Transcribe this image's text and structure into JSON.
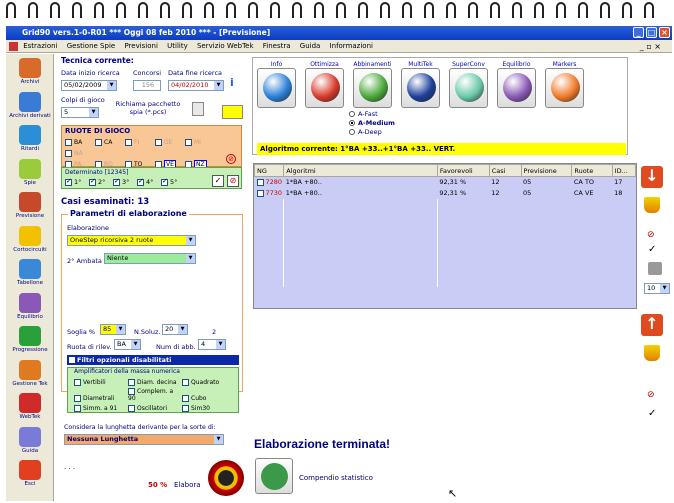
{
  "window": {
    "title": "Grid90 vers.1-0-R01  ***  Oggi 08 feb 2010  ***  - [Previsione]"
  },
  "menu": [
    "Estrazioni",
    "Gestione Spie",
    "Previsioni",
    "Utility",
    "Servizio WebTek",
    "Finestra",
    "Guida",
    "Informazioni"
  ],
  "sidebar": [
    {
      "label": "Archivi",
      "color": "#d86b2a"
    },
    {
      "label": "Archivi derivati",
      "color": "#3a7bd5"
    },
    {
      "label": "Ritardi",
      "color": "#2a8fd6"
    },
    {
      "label": "Spie",
      "color": "#9acb3a"
    },
    {
      "label": "Previsione",
      "color": "#c64a2a"
    },
    {
      "label": "Cortocircuiti",
      "color": "#f2c200"
    },
    {
      "label": "Tabellone",
      "color": "#3a88d8"
    },
    {
      "label": "Equilibrio",
      "color": "#8a58b5"
    },
    {
      "label": "Progressione",
      "color": "#2aa03a"
    },
    {
      "label": "Gestione Tek",
      "color": "#e07a20"
    },
    {
      "label": "WebTek",
      "color": "#d02a2a"
    },
    {
      "label": "Guida",
      "color": "#7a7ad8"
    },
    {
      "label": "Esci",
      "color": "#e04020"
    }
  ],
  "left": {
    "section_title": "Tecnica corrente:",
    "data_inizio_label": "Data inizio ricerca",
    "data_inizio": "05/02/2009",
    "concorsi_label": "Concorsi",
    "concorsi": "156",
    "data_fine_label": "Data fine ricerca",
    "data_fine": "04/02/2010",
    "colpi_label": "Colpi di gioco",
    "colpi": "5",
    "richiama_label": "Richiama pacchetto spia (*.pcs)",
    "ruote_title": "RUOTE DI GIOCO",
    "ruote": [
      {
        "name": "BA",
        "checked": false,
        "active": true
      },
      {
        "name": "CA",
        "checked": false,
        "active": true
      },
      {
        "name": "FI",
        "checked": false,
        "active": false
      },
      {
        "name": "GE",
        "checked": false,
        "active": false
      },
      {
        "name": "MI",
        "checked": false,
        "active": false
      },
      {
        "name": "NA",
        "checked": false,
        "active": false
      },
      {
        "name": "PA",
        "checked": false,
        "active": false
      },
      {
        "name": "RO",
        "checked": false,
        "active": false
      },
      {
        "name": "TO",
        "checked": false,
        "active": true
      },
      {
        "name": "VE",
        "checked": true,
        "active": true
      },
      {
        "name": "NZ",
        "checked": true,
        "active": true
      }
    ],
    "determinato_title": "Determinato [12345]",
    "determinato": [
      "1°",
      "2°",
      "3°",
      "4°",
      "5°"
    ],
    "casi_esaminati": "Casi esaminati: 13",
    "parametri_title": "Parametri di elaborazione",
    "elaborazione_label": "Elaborazione",
    "elaborazione": "OneStep ricorsiva 2 ruote",
    "ambata_label": "2° Ambata",
    "ambata": "Niente",
    "soglia_label": "Soglia %",
    "soglia": "85",
    "nsoluz_label": "N.Soluz.",
    "nsoluz": "20",
    "nsoluz_extra": "2",
    "ruota_rilev_label": "Ruota di rilev.",
    "ruota_rilev": "BA",
    "num_abb_label": "Num di abb.",
    "num_abb": "4",
    "filtri_label": "Filtri opzionali disabilitati",
    "amplificatori_title": "Amplificatori della massa numerica",
    "amplificatori": [
      "Vertibili",
      "Diam. decina",
      "Quadrato",
      "Diametrali",
      "Complem. a 90",
      "Cubo",
      "Simm. a 91",
      "Oscillatori",
      "Sim30"
    ],
    "lunghetta_label": "Considera la lunghetta derivante per la sorte di:",
    "lunghetta": "Nessuna Lunghetta",
    "dots": ". . .",
    "percent": "50 %",
    "elabora": "Elabora"
  },
  "tools": [
    {
      "label": "Info",
      "color": "#2a7fd6"
    },
    {
      "label": "Ottimizza",
      "color": "#d83a2a"
    },
    {
      "label": "Abbinamenti",
      "color": "#4aa83a"
    },
    {
      "label": "MultiTek",
      "color": "#1c3f9a"
    },
    {
      "label": "SuperConv",
      "color": "#6ac8a8"
    },
    {
      "label": "Equilibrio",
      "color": "#8a58b5"
    },
    {
      "label": "Markers",
      "color": "#f07a2a"
    }
  ],
  "modes": [
    {
      "label": "A-Fast",
      "selected": false
    },
    {
      "label": "A-Medium",
      "selected": true
    },
    {
      "label": "A-Deep",
      "selected": false
    }
  ],
  "algoritmo_corrente": "Algoritmo corrente: 1°BA +33..+1°BA +33.. VERT.",
  "table": {
    "headers": [
      "NG",
      "Algoritmi",
      "Favorevoli",
      "Casi",
      "Previsione",
      "Ruote",
      "ID..."
    ],
    "rows": [
      {
        "ng": "7280",
        "alg": "1*BA +80..",
        "fav": "92,31 %",
        "casi": "12",
        "prev": "05",
        "ruote": "CA TO",
        "id": "17"
      },
      {
        "ng": "7730",
        "alg": "1*BA +80..",
        "fav": "92,31 %",
        "casi": "12",
        "prev": "05",
        "ruote": "CA VE",
        "id": "18"
      }
    ]
  },
  "status": "Elaborazione terminata!",
  "compendio": "Compendio statistico",
  "right": {
    "page": "10"
  },
  "colors": {
    "accent": "#0a3cc4",
    "highlight": "#ffff00",
    "row": "#c9ccf5"
  }
}
